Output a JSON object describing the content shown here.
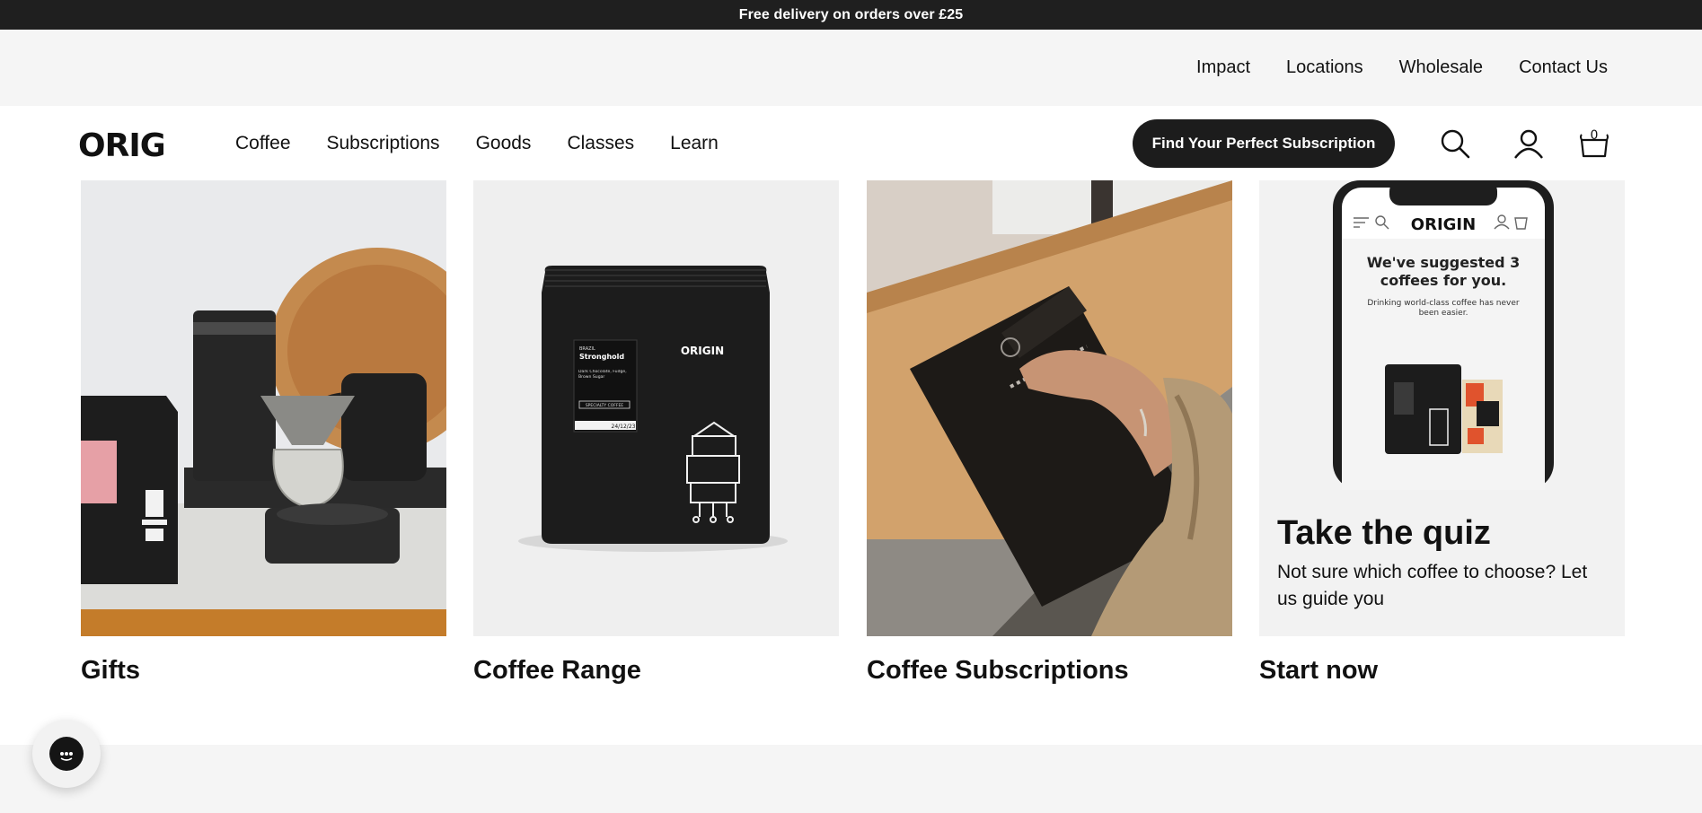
{
  "announcement": "Free delivery on orders over £25",
  "utility_nav": [
    "Impact",
    "Locations",
    "Wholesale",
    "Contact Us"
  ],
  "brand": {
    "logo_text": "ORIGIN"
  },
  "main_nav": [
    "Coffee",
    "Subscriptions",
    "Goods",
    "Classes",
    "Learn"
  ],
  "cta_label": "Find Your Perfect Subscription",
  "header_icons": [
    "search-icon",
    "account-icon",
    "cart-icon"
  ],
  "cart_count": "0",
  "cards": [
    {
      "label": "Gifts"
    },
    {
      "label": "Coffee Range"
    },
    {
      "label": "Coffee Subscriptions"
    },
    {
      "label": "Start now"
    }
  ],
  "quiz": {
    "title": "Take the quiz",
    "text": "Not sure which coffee to choose? Let us guide you",
    "phone_headline": "We've suggested 3 coffees for you.",
    "phone_sub": "Drinking world-class coffee has never been easier."
  },
  "product_bag": {
    "origin": "BRAZIL",
    "name": "Stronghold",
    "notes": "Dark Chocolate, Fudge, Brown Sugar",
    "badge": "SPECIALTY COFFEE",
    "date": "24/12/23"
  },
  "colors": {
    "dark": "#1f1f1f",
    "light_bg": "#f5f5f5",
    "wood": "#c48a4e"
  }
}
